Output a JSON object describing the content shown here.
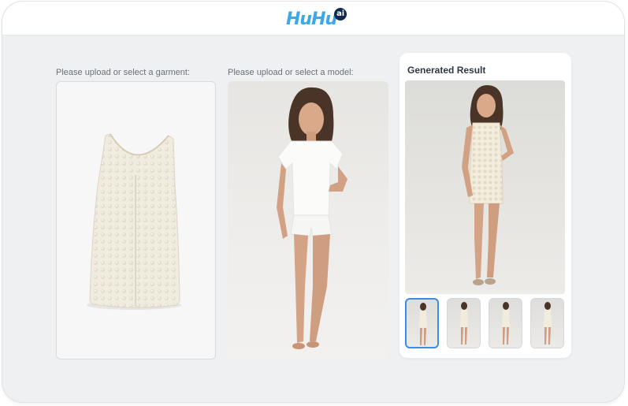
{
  "app": {
    "logo_text": "HuHu",
    "logo_badge": "ai"
  },
  "garment_section": {
    "label": "Please upload or select a garment:"
  },
  "model_section": {
    "label": "Please upload or select a model:"
  },
  "result_section": {
    "title": "Generated Result",
    "thumbnails": [
      {
        "selected": true
      },
      {
        "selected": false
      },
      {
        "selected": false
      },
      {
        "selected": false
      }
    ]
  },
  "colors": {
    "accent": "#3c8ee0",
    "logo": "#3ba8e8",
    "logo_badge": "#13294b",
    "background": "#eef0f2"
  }
}
